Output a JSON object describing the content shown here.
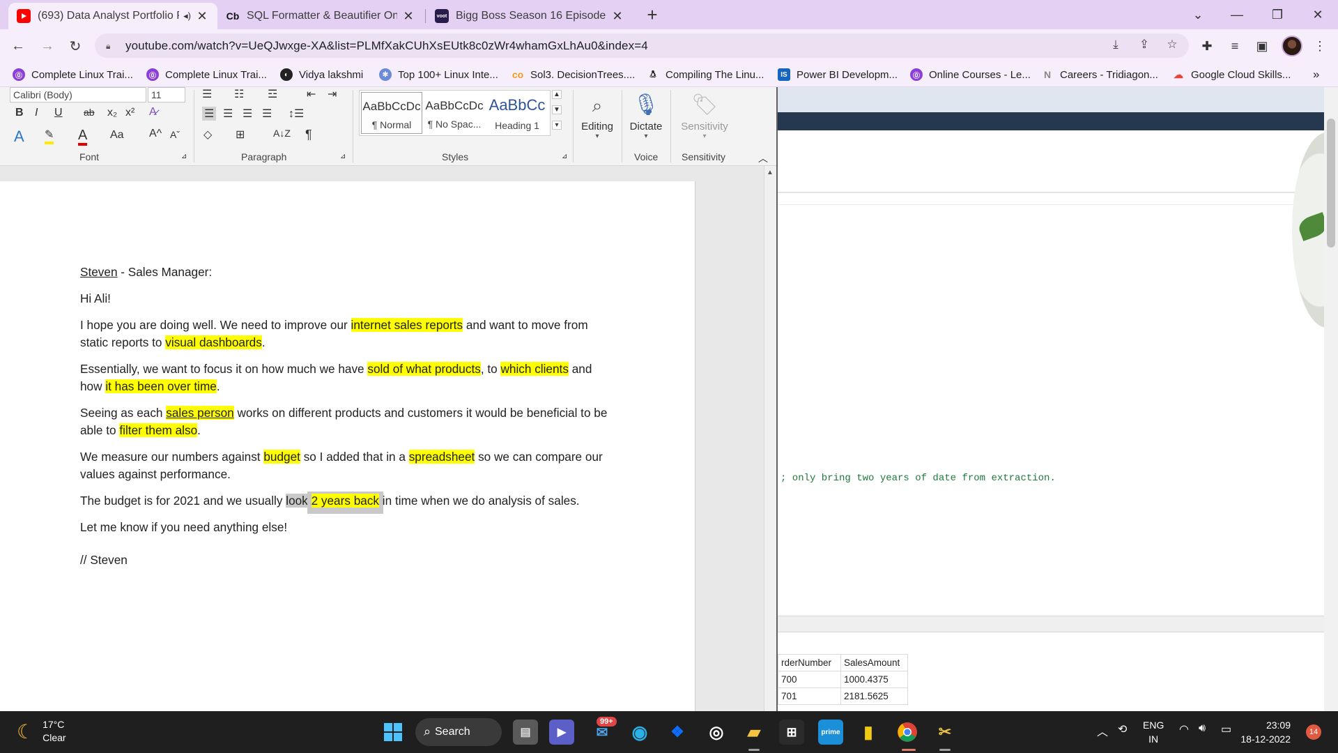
{
  "browser": {
    "tabs": [
      {
        "title": "(693) Data Analyst Portfolio P",
        "favicon": "youtube-icon",
        "active": true
      },
      {
        "title": "SQL Formatter & Beautifier Onlin",
        "favicon": "cb-icon",
        "active": false
      },
      {
        "title": "Bigg Boss Season 16 Episode 60",
        "favicon": "voot-icon",
        "active": false
      }
    ],
    "tab_favicon_text": {
      "cb": "Cb",
      "voot": "voot"
    },
    "url": "youtube.com/watch?v=UeQJwxge-XA&list=PLMfXakCUhXsEUtk8c0zWr4whamGxLhAu0&index=4",
    "bookmarks": [
      "Complete Linux Trai...",
      "Complete Linux Trai...",
      "Vidya lakshmi",
      "Top 100+ Linux Inte...",
      "Sol3. DecisionTrees....",
      "Compiling The Linu...",
      "Power BI Developm...",
      "Online Courses - Le...",
      "Careers - Tridiagon...",
      "Google Cloud Skills..."
    ],
    "bookmark_more": "»",
    "colors": {
      "tabstrip": "#e3d0f3",
      "toolbar": "#f7eefc",
      "accent": "#ff0000"
    }
  },
  "word": {
    "font_name": "Calibri (Body)",
    "font_size": "11",
    "groups": {
      "font": "Font",
      "paragraph": "Paragraph",
      "styles": "Styles",
      "voice": "Voice",
      "sensitivity": "Sensitivity"
    },
    "styles": [
      {
        "sample": "AaBbCcDc",
        "name": "¶ Normal"
      },
      {
        "sample": "AaBbCcDc",
        "name": "¶ No Spac..."
      },
      {
        "sample": "AaBbCc",
        "name": "Heading 1"
      }
    ],
    "buttons": {
      "editing": "Editing",
      "dictate": "Dictate",
      "sensitivity": "Sensitivity"
    },
    "font_buttons": [
      "B",
      "I",
      "U",
      "ab",
      "x₂",
      "x²"
    ],
    "misc_glyphs": {
      "case": "Aa",
      "grow": "A^",
      "shrink": "Aˇ",
      "pilcrow": "¶",
      "sort": "A↓Z"
    },
    "document": {
      "header_name": "Steven",
      "header_rest": " - Sales Manager:",
      "greeting": "Hi Ali!",
      "p1_a": "I hope you are doing well. We need to improve our ",
      "p1_h1": "internet sales reports",
      "p1_b": " and want to move from static reports to ",
      "p1_h2": "visual dashboards",
      "p1_c": ".",
      "p2_a": "Essentially, we want to focus it on how much we have ",
      "p2_h1": "sold of what products",
      "p2_b": ", to ",
      "p2_h2": "which clients",
      "p2_c": " and how ",
      "p2_h3": "it has been over time",
      "p2_d": ".",
      "p3_a": "Seeing as each ",
      "p3_h1": "sales person",
      "p3_b": " works on different products and customers it would be beneficial to be able to ",
      "p3_h2": "filter them also",
      "p3_c": ".",
      "p4_a": "We measure our numbers against ",
      "p4_h1": "budget",
      "p4_b": " so I added that in a ",
      "p4_h2": "spreadsheet",
      "p4_c": " so we can compare our values against performance.",
      "p5_a": "The budget is for 2021 and we usually ",
      "p5_sel": "look ",
      "p5_h1": "2 years back",
      "p5_b": " in time when we do analysis of sales.",
      "p6": "Let me know if you need anything else!",
      "sign": "// Steven"
    }
  },
  "video": {
    "sql_comment": "; only bring two years of date from extraction.",
    "grid_headers": [
      "rderNumber",
      "SalesAmount"
    ],
    "grid_rows": [
      [
        "700",
        "1000.4375"
      ],
      [
        "701",
        "2181.5625"
      ]
    ]
  },
  "taskbar": {
    "temp": "17°C",
    "condition": "Clear",
    "search": "Search",
    "mail_badge": "99+",
    "lang1": "ENG",
    "lang2": "IN",
    "time": "23:09",
    "date": "18-12-2022",
    "notifications": "14"
  }
}
